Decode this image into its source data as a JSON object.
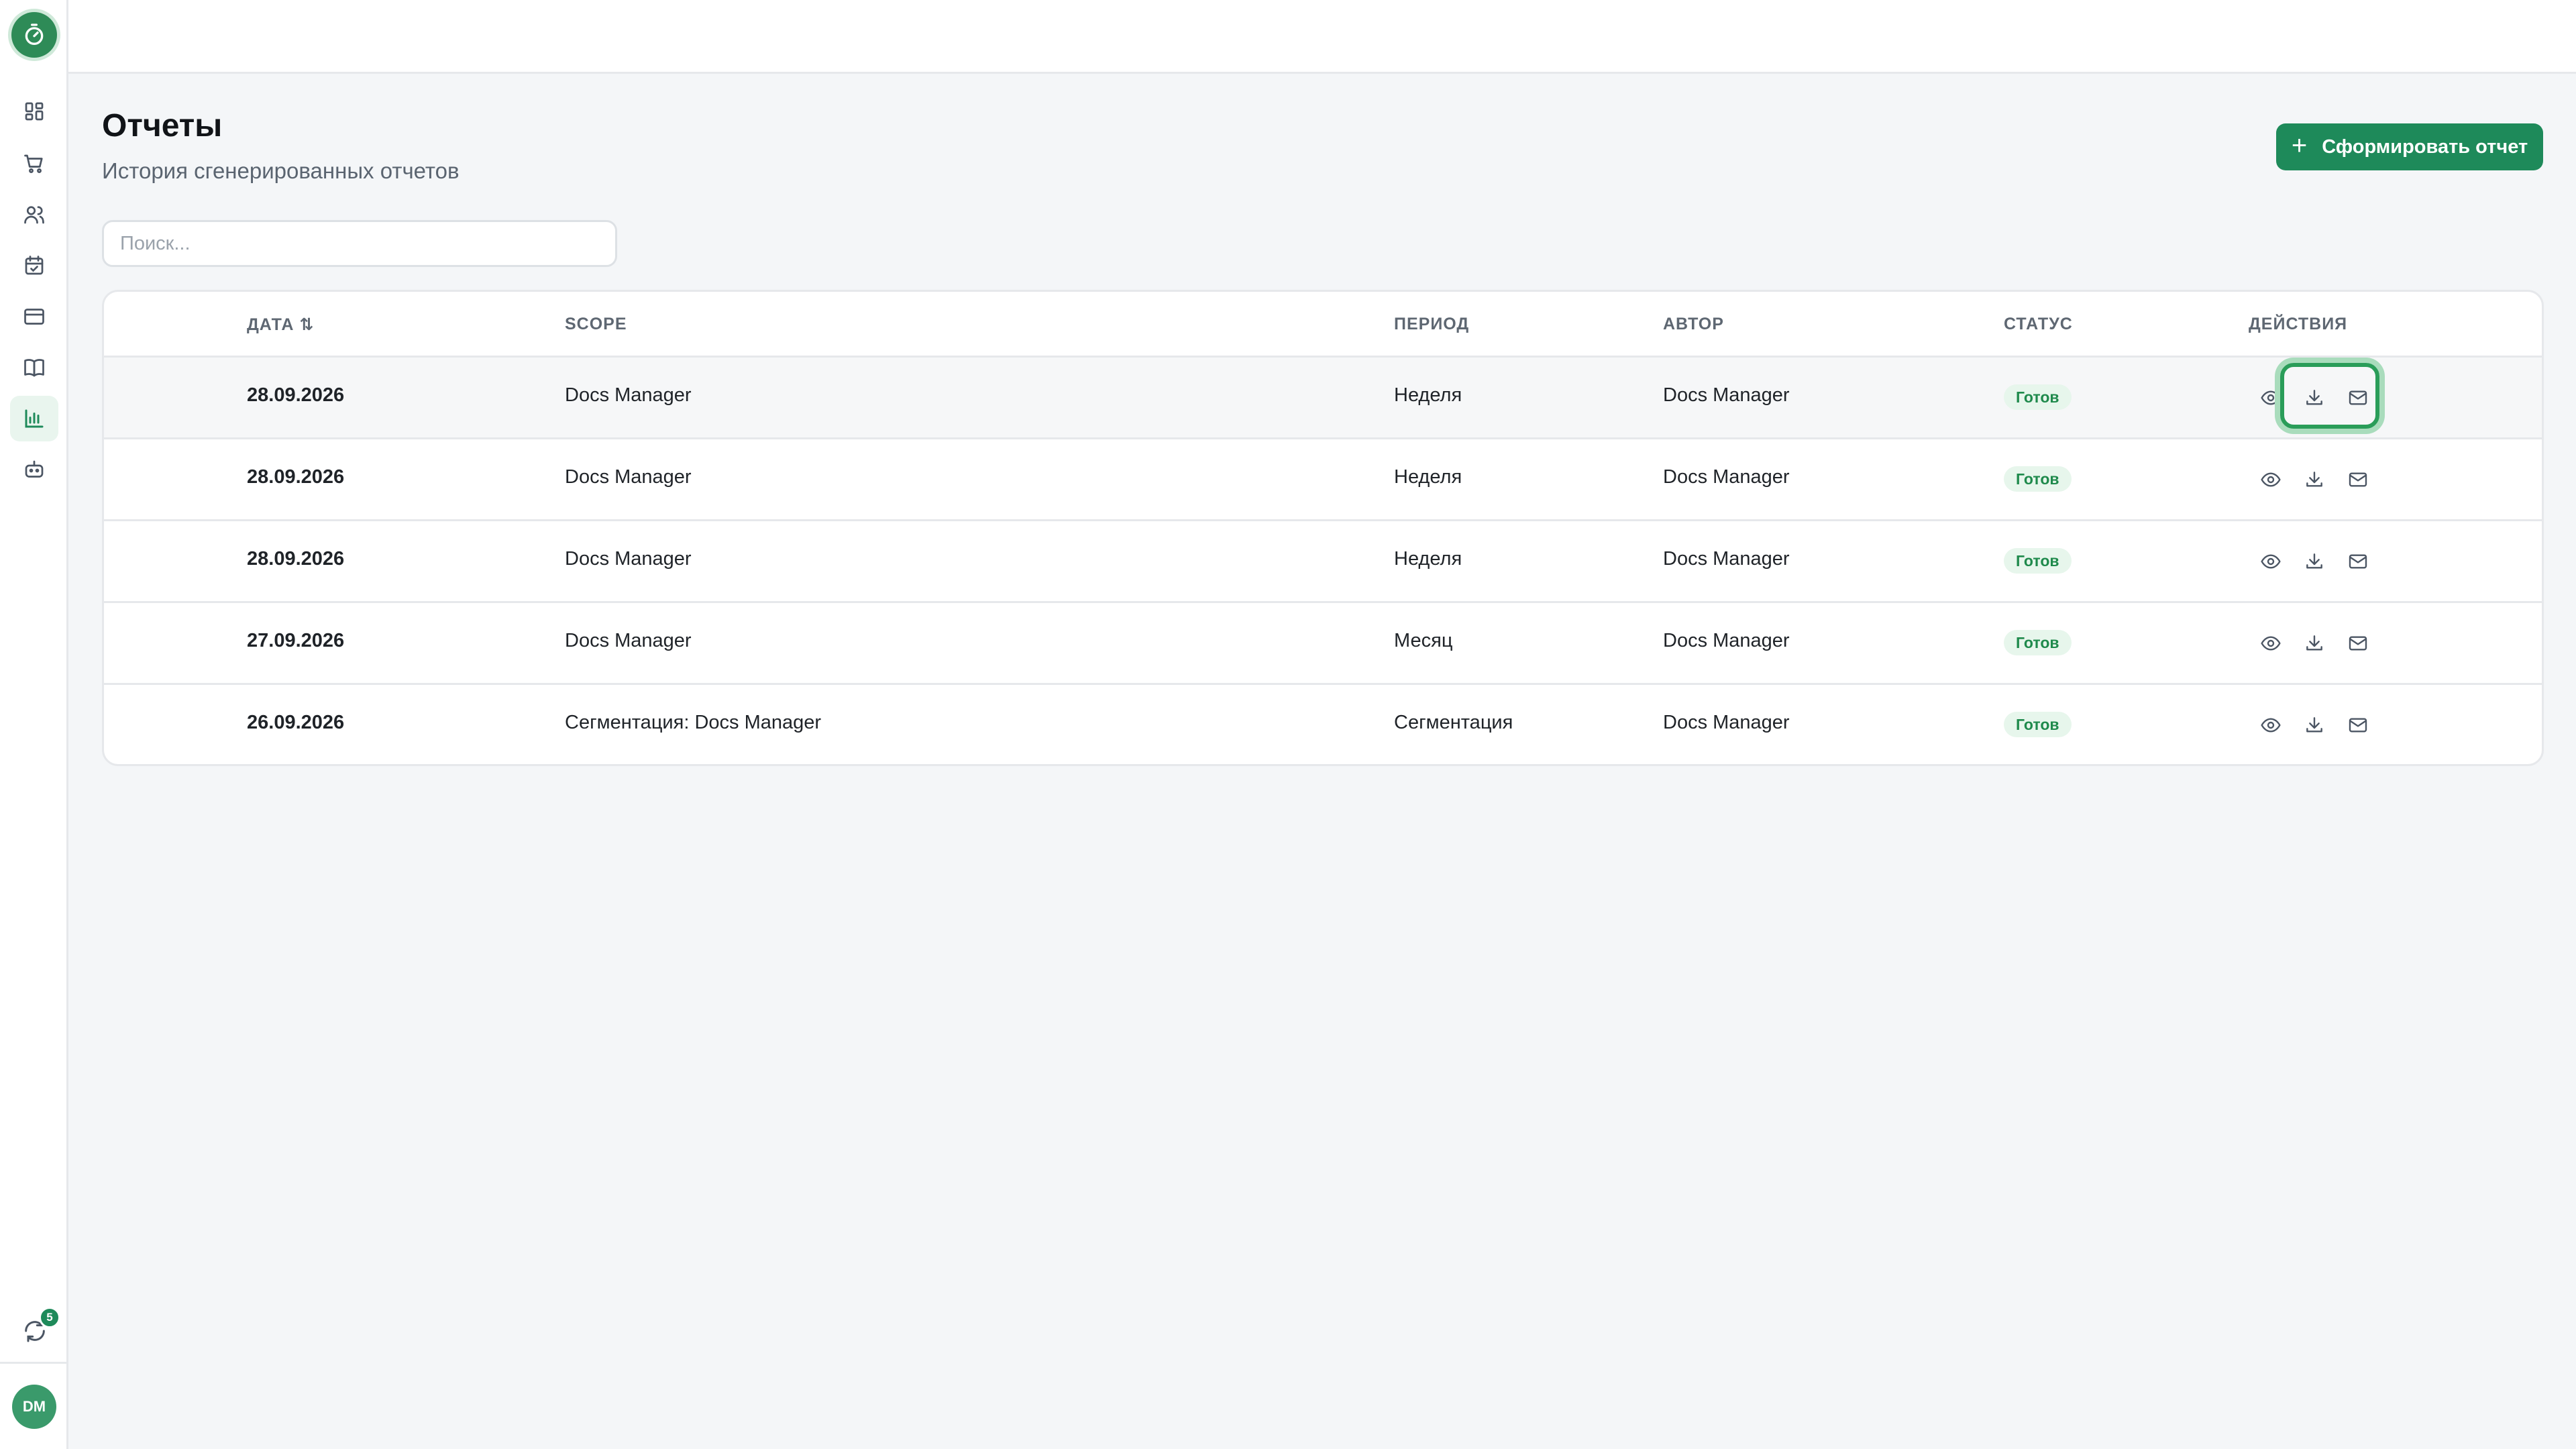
{
  "app": {
    "logo_icon": "stopwatch-icon",
    "accent_color": "#1e8a5a"
  },
  "sidebar": {
    "items": [
      {
        "name": "dashboard",
        "icon": "dashboard-icon"
      },
      {
        "name": "orders",
        "icon": "cart-icon"
      },
      {
        "name": "users",
        "icon": "users-icon"
      },
      {
        "name": "calendar",
        "icon": "calendar-check-icon"
      },
      {
        "name": "billing",
        "icon": "credit-card-icon"
      },
      {
        "name": "docs",
        "icon": "book-icon"
      },
      {
        "name": "reports",
        "icon": "bar-chart-icon",
        "active": true
      },
      {
        "name": "bot",
        "icon": "bot-icon"
      }
    ],
    "sync_badge": "5",
    "avatar_initials": "DM"
  },
  "header": {
    "title": "Отчеты",
    "subtitle": "История сгенерированных отчетов",
    "primary_button_label": "Сформировать отчет"
  },
  "search": {
    "placeholder": "Поиск...",
    "value": ""
  },
  "table": {
    "columns": [
      "ДАТА",
      "SCOPE",
      "ПЕРИОД",
      "АВТОР",
      "СТАТУС",
      "ДЕЙСТВИЯ"
    ],
    "sort_indicator": "⇅",
    "rows": [
      {
        "date": "28.09.2026",
        "scope": "Docs Manager",
        "period": "Неделя",
        "author": "Docs Manager",
        "status": "Готов"
      },
      {
        "date": "28.09.2026",
        "scope": "Docs Manager",
        "period": "Неделя",
        "author": "Docs Manager",
        "status": "Готов"
      },
      {
        "date": "28.09.2026",
        "scope": "Docs Manager",
        "period": "Неделя",
        "author": "Docs Manager",
        "status": "Готов"
      },
      {
        "date": "27.09.2026",
        "scope": "Docs Manager",
        "period": "Месяц",
        "author": "Docs Manager",
        "status": "Готов"
      },
      {
        "date": "26.09.2026",
        "scope": "Сегментация: Docs Manager",
        "period": "Сегментация",
        "author": "Docs Manager",
        "status": "Готов"
      }
    ],
    "actions": [
      "eye-icon",
      "download-icon",
      "mail-icon"
    ]
  }
}
